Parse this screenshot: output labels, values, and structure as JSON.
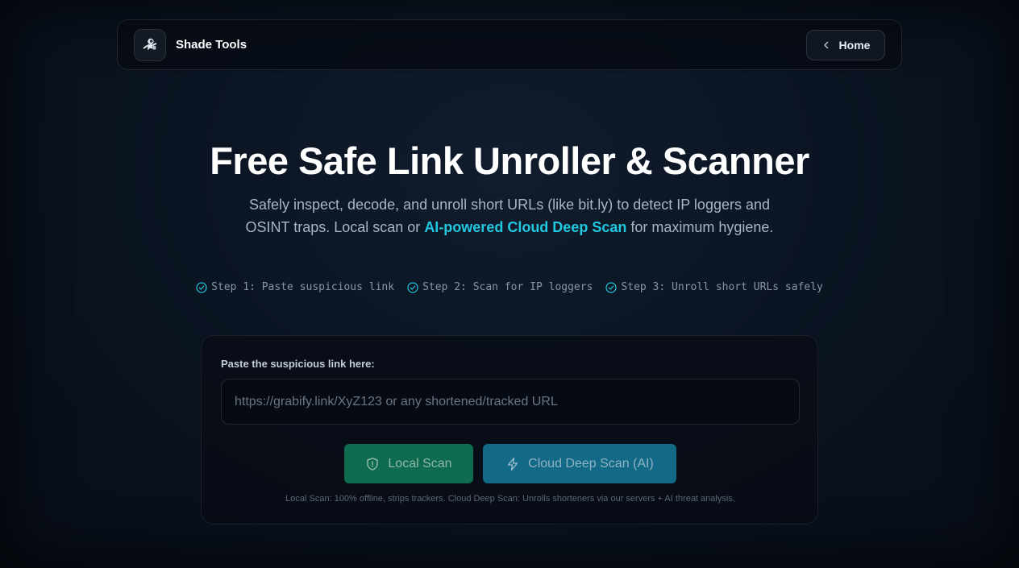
{
  "navbar": {
    "brand": "Shade Tools",
    "logo_icon": "astronaut-icon",
    "home_label": "Home",
    "home_icon": "chevron-left-icon"
  },
  "hero": {
    "title": "Free Safe Link Unroller & Scanner",
    "subtitle_before": "Safely inspect, decode, and unroll short URLs (like bit.ly) to detect IP loggers and OSINT traps. Local scan or ",
    "subtitle_highlight": "AI-powered Cloud Deep Scan",
    "subtitle_after": " for maximum hygiene."
  },
  "steps": [
    {
      "label": "Step 1: Paste suspicious link",
      "icon": "check-circle-icon"
    },
    {
      "label": "Step 2: Scan for IP loggers",
      "icon": "check-circle-icon"
    },
    {
      "label": "Step 3: Unroll short URLs safely",
      "icon": "check-circle-icon"
    }
  ],
  "scanner": {
    "input_label": "Paste the suspicious link here:",
    "input_placeholder": "https://grabify.link/XyZ123 or any shortened/tracked URL",
    "input_value": "",
    "local_scan_label": "Local Scan",
    "local_scan_icon": "shield-icon",
    "cloud_scan_label": "Cloud Deep Scan (AI)",
    "cloud_scan_icon": "lightning-icon",
    "note": "Local Scan: 100% offline, strips trackers. Cloud Deep Scan: Unrolls shorteners via our servers + AI threat analysis."
  },
  "colors": {
    "accent": "#22c7e0",
    "local_button": "#0f6b4f",
    "cloud_button": "#136a86",
    "background": "#0b1422"
  }
}
